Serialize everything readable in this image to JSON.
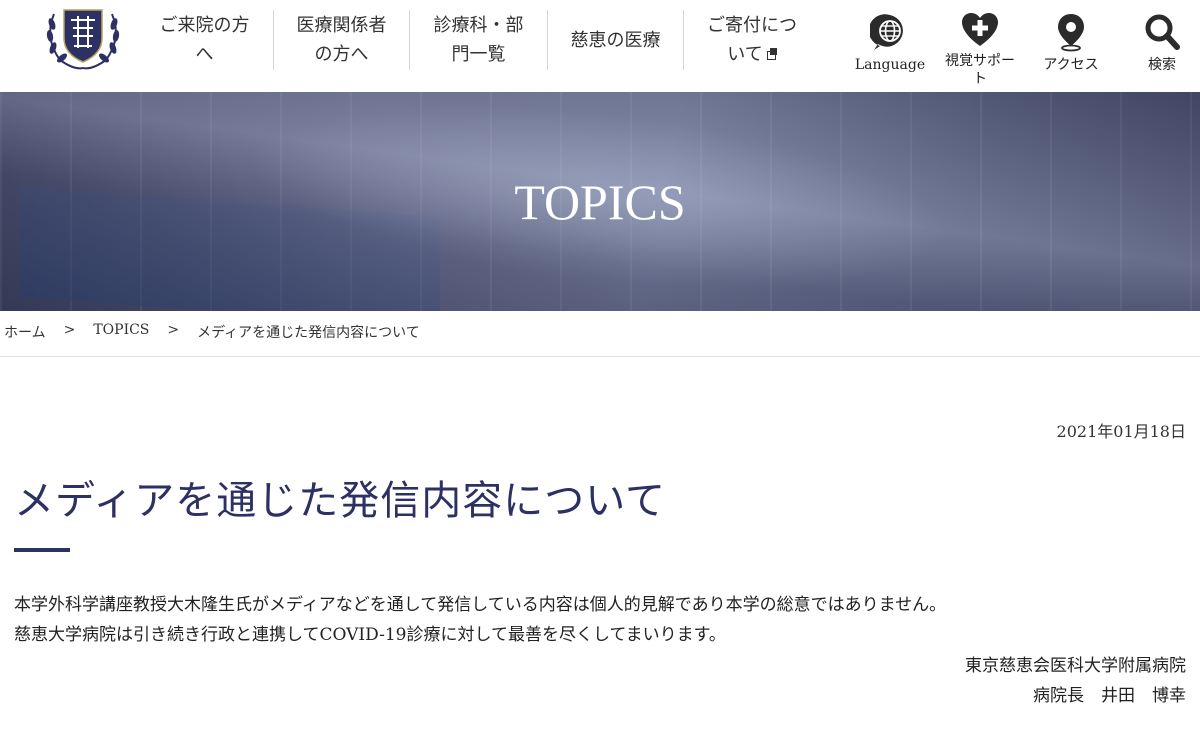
{
  "header": {
    "logo_alt": "慈恵医大",
    "nav": [
      {
        "label": "ご来院の方\nへ",
        "external": false
      },
      {
        "label": "医療関係者\nの方へ",
        "external": false
      },
      {
        "label": "診療科・部\n門一覧",
        "external": false
      },
      {
        "label": "慈恵の医療",
        "external": false
      },
      {
        "label": "ご寄付につ\nいて",
        "external": true
      }
    ],
    "utilities": [
      {
        "label": "Language",
        "icon": "globe-icon"
      },
      {
        "label": "視覚サポー\nト",
        "icon": "heart-plus-icon"
      },
      {
        "label": "アクセス",
        "icon": "map-pin-icon"
      },
      {
        "label": "検索",
        "icon": "search-icon"
      }
    ]
  },
  "hero": {
    "title": "TOPICS"
  },
  "breadcrumb": {
    "items": [
      "ホーム",
      "TOPICS",
      "メディアを通じた発信内容について"
    ],
    "separator": ">"
  },
  "article": {
    "date": "2021年01月18日",
    "title": "メディアを通じた発信内容について",
    "paragraphs": [
      "本学外科学講座教授大木隆生氏がメディアなどを通して発信している内容は個人的見解であり本学の総意ではありません。",
      "慈恵大学病院は引き続き行政と連携してCOVID-19診療に対して最善を尽くしてまいります。"
    ],
    "signature": [
      "東京慈恵会医科大学附属病院",
      "病院長　井田　博幸"
    ]
  },
  "colors": {
    "brand_navy": "#2d3063",
    "hero_overlay": "#6c7392"
  }
}
